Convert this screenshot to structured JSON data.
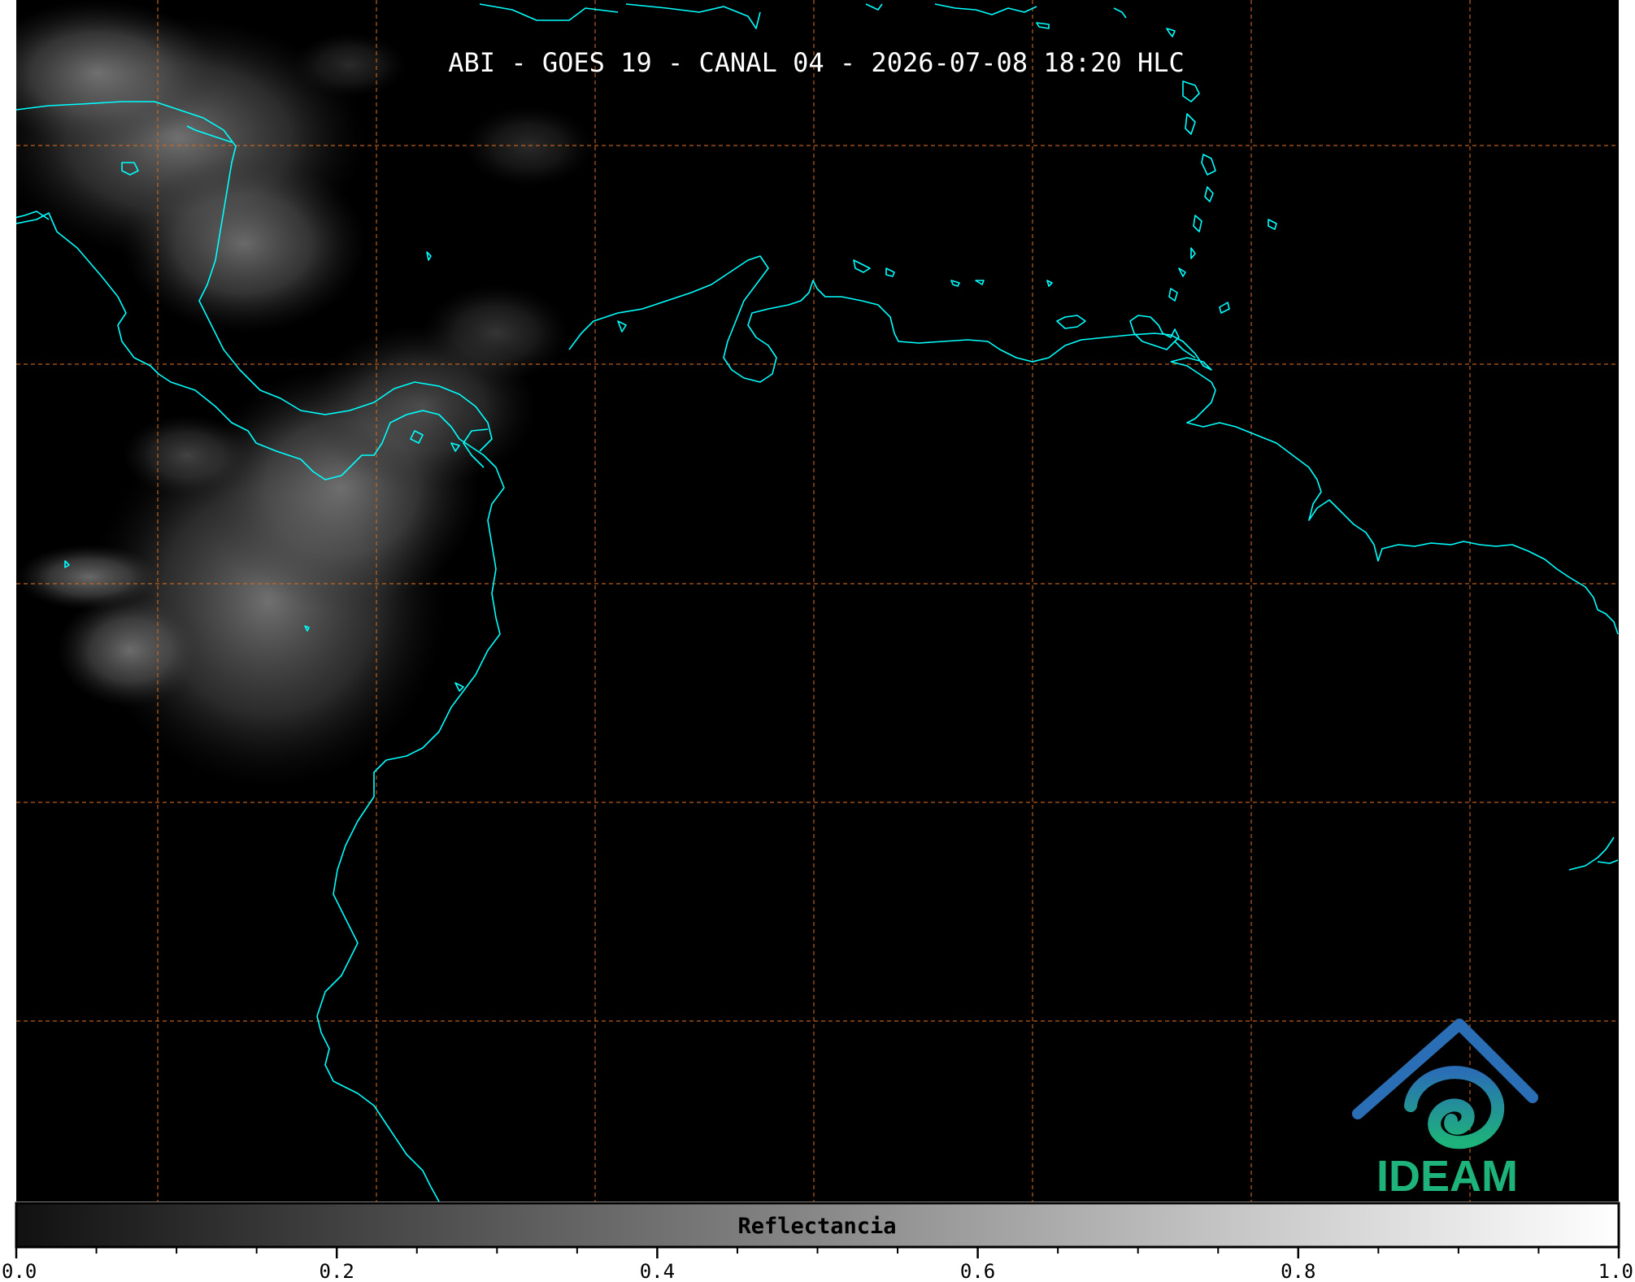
{
  "title": "ABI - GOES 19 - CANAL 04 - 2026-07-08 18:20 HLC",
  "colorbar": {
    "label": "Reflectancia",
    "range": [
      0.0,
      1.0
    ],
    "tick_labels": [
      "0.0",
      "0.2",
      "0.4",
      "0.6",
      "0.8",
      "1.0"
    ],
    "major_ticks": [
      0.0,
      0.2,
      0.4,
      0.6,
      0.8,
      1.0
    ],
    "minor_ticks": [
      0.05,
      0.1,
      0.15,
      0.25,
      0.3,
      0.35,
      0.45,
      0.5,
      0.55,
      0.65,
      0.7,
      0.75,
      0.85,
      0.9,
      0.95
    ],
    "colormap": [
      "#111111",
      "#ffffff"
    ]
  },
  "logo": {
    "text": "IDEAM"
  },
  "colors": {
    "background": "#000000",
    "coastline": "#00ffff",
    "gridline": "#d2691e",
    "cloud": "#9a9a9a",
    "logo_blue": "#2a6fb5",
    "logo_teal": "#1aa89a",
    "logo_green": "#1db37a",
    "title_text": "#ffffff"
  }
}
